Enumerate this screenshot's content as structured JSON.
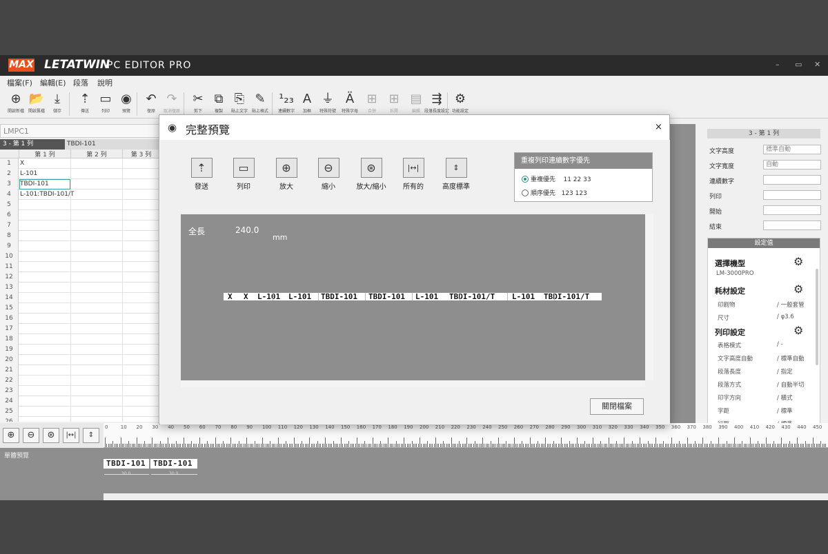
{
  "app": {
    "brand_max": "MAX",
    "brand_name": "LETATWIN",
    "brand_sub": "PC EDITOR PRO",
    "win_controls": [
      "–",
      "▭",
      "✕"
    ]
  },
  "menu": [
    "檔案(F)",
    "編輯(E)",
    "段落",
    "說明"
  ],
  "toolbar": [
    {
      "icon": "new-icon",
      "glyph": "⊕",
      "label": "開啟新檔"
    },
    {
      "icon": "open-icon",
      "glyph": "📂",
      "label": "開啟舊檔"
    },
    {
      "icon": "save-icon",
      "glyph": "⤓",
      "label": "儲存"
    },
    {
      "icon": "send-icon",
      "glyph": "⇡",
      "label": "傳送"
    },
    {
      "icon": "print-icon",
      "glyph": "▭",
      "label": "列印"
    },
    {
      "icon": "preview-icon",
      "glyph": "◉",
      "label": "預覽"
    },
    {
      "icon": "undo-icon",
      "glyph": "↶",
      "label": "復原"
    },
    {
      "icon": "redo-icon",
      "glyph": "↷",
      "label": "取消復原"
    },
    {
      "icon": "cut-icon",
      "glyph": "✂",
      "label": "剪下"
    },
    {
      "icon": "copy-icon",
      "glyph": "⧉",
      "label": "複製"
    },
    {
      "icon": "paste-text-icon",
      "glyph": "⎘",
      "label": "貼上文字"
    },
    {
      "icon": "paste-format-icon",
      "glyph": "✎",
      "label": "貼上格式"
    },
    {
      "icon": "serial-number-icon",
      "glyph": "¹₂₃",
      "label": "連續數字"
    },
    {
      "icon": "frame-icon",
      "glyph": "A",
      "label": "加框"
    },
    {
      "icon": "special-symbol-icon",
      "glyph": "⏚",
      "label": "特殊符號"
    },
    {
      "icon": "special-char-icon",
      "glyph": "Ä",
      "label": "特殊字母"
    },
    {
      "icon": "merge-icon",
      "glyph": "⊞",
      "label": "合併"
    },
    {
      "icon": "split-icon",
      "glyph": "⊞",
      "label": "拆開"
    },
    {
      "icon": "edit-icon",
      "glyph": "▤",
      "label": "編輯"
    },
    {
      "icon": "paragraph-height-icon",
      "glyph": "⇶",
      "label": "段落長度設定"
    },
    {
      "icon": "function-settings-icon",
      "glyph": "⚙",
      "label": "功能設定"
    }
  ],
  "document": {
    "name": "LMPC1"
  },
  "sheet": {
    "current_cell": "3 - 第 1 列",
    "current_value": "TBDI-101",
    "columns": [
      "第 1 列",
      "第 2 列",
      "第 3 列"
    ],
    "rows": [
      {
        "num": "1",
        "c1": "X"
      },
      {
        "num": "2",
        "c1": "L-101"
      },
      {
        "num": "3",
        "c1": "TBDI-101"
      },
      {
        "num": "4",
        "c1": "L-101:TBDI-101/T"
      },
      {
        "num": "5",
        "c1": ""
      },
      {
        "num": "6",
        "c1": ""
      },
      {
        "num": "7",
        "c1": ""
      },
      {
        "num": "8",
        "c1": ""
      },
      {
        "num": "9",
        "c1": ""
      },
      {
        "num": "10",
        "c1": ""
      },
      {
        "num": "11",
        "c1": ""
      },
      {
        "num": "12",
        "c1": ""
      },
      {
        "num": "13",
        "c1": ""
      },
      {
        "num": "14",
        "c1": ""
      },
      {
        "num": "15",
        "c1": ""
      },
      {
        "num": "16",
        "c1": ""
      },
      {
        "num": "17",
        "c1": ""
      },
      {
        "num": "18",
        "c1": ""
      },
      {
        "num": "19",
        "c1": ""
      },
      {
        "num": "20",
        "c1": ""
      },
      {
        "num": "21",
        "c1": ""
      },
      {
        "num": "22",
        "c1": ""
      },
      {
        "num": "23",
        "c1": ""
      },
      {
        "num": "24",
        "c1": ""
      },
      {
        "num": "25",
        "c1": ""
      },
      {
        "num": "26",
        "c1": ""
      }
    ]
  },
  "right_panel": {
    "header": "3 - 第 1 列",
    "fields": [
      {
        "label": "文字高度",
        "value": "標準自動"
      },
      {
        "label": "文字寬度",
        "value": "自動"
      },
      {
        "label": "連續數字",
        "value": ""
      },
      {
        "label": "列印",
        "value": ""
      },
      {
        "label": "開始",
        "value": ""
      },
      {
        "label": "結束",
        "value": ""
      }
    ],
    "settings_header": "設定值",
    "model_title": "選擇機型",
    "model_value": "LM-3000PRO",
    "consumable_title": "耗材設定",
    "consumables": [
      {
        "label": "印刷物",
        "value": "/ 一般套管"
      },
      {
        "label": "尺寸",
        "value": "/ φ3.6"
      }
    ],
    "print_title": "列印設定",
    "print_items": [
      {
        "label": "表格模式",
        "value": "/ -"
      },
      {
        "label": "文字高度自動",
        "value": "/ 標準自動"
      },
      {
        "label": "段落長度",
        "value": "/ 指定"
      },
      {
        "label": "段落方式",
        "value": "/ 自動半切"
      },
      {
        "label": "印字方向",
        "value": "/ 橫式"
      },
      {
        "label": "字距",
        "value": "/ 標準"
      },
      {
        "label": "行距",
        "value": "/ 標準"
      }
    ]
  },
  "bottom": {
    "preview_label": "單體預覽",
    "zoom_buttons": [
      "⊕",
      "⊖",
      "⊛",
      "|↔|",
      "⇕"
    ],
    "ruler_ticks": [
      "0",
      "10",
      "20",
      "30",
      "40",
      "50",
      "60",
      "70",
      "80",
      "90",
      "100",
      "110",
      "120",
      "130",
      "140",
      "150",
      "160",
      "170",
      "180",
      "190",
      "200",
      "210",
      "220",
      "230",
      "240",
      "250",
      "260",
      "270",
      "280",
      "290",
      "300",
      "310",
      "320",
      "330",
      "340",
      "350",
      "360",
      "370",
      "380",
      "390",
      "400",
      "410",
      "420",
      "430",
      "440",
      "450"
    ],
    "tapes": [
      {
        "text": "TBDI-101",
        "dim": "30.0"
      },
      {
        "text": "TBDI-101",
        "dim": "30.0"
      }
    ]
  },
  "dialog": {
    "title": "完整預覽",
    "close": "×",
    "buttons": [
      {
        "icon": "send-icon",
        "glyph": "⇡",
        "label": "發送"
      },
      {
        "icon": "print-icon",
        "glyph": "▭",
        "label": "列印"
      },
      {
        "icon": "zoom-in-icon",
        "glyph": "⊕",
        "label": "放大"
      },
      {
        "icon": "zoom-out-icon",
        "glyph": "⊖",
        "label": "縮小"
      },
      {
        "icon": "zoom-fit-icon",
        "glyph": "⊛",
        "label": "放大/縮小"
      },
      {
        "icon": "fit-width-icon",
        "glyph": "|↔|",
        "label": "所有的"
      },
      {
        "icon": "fit-height-icon",
        "glyph": "⇕",
        "label": "高度標準"
      }
    ],
    "priority": {
      "title": "重複列印連續數字優先",
      "options": [
        {
          "label": "重複優先",
          "example": "11 22 33",
          "selected": true
        },
        {
          "label": "順序優先",
          "example": "123 123",
          "selected": false
        }
      ]
    },
    "length_label": "全長",
    "length_value": "240.0",
    "length_unit": "mm",
    "tape_segments": [
      "X",
      "X",
      "L-101",
      "L-101",
      "TBDI-101",
      "TBDI-101",
      "L-101",
      "TBDI-101/T",
      "L-101",
      "TBDI-101/T"
    ],
    "close_button": "關閉檔案"
  }
}
